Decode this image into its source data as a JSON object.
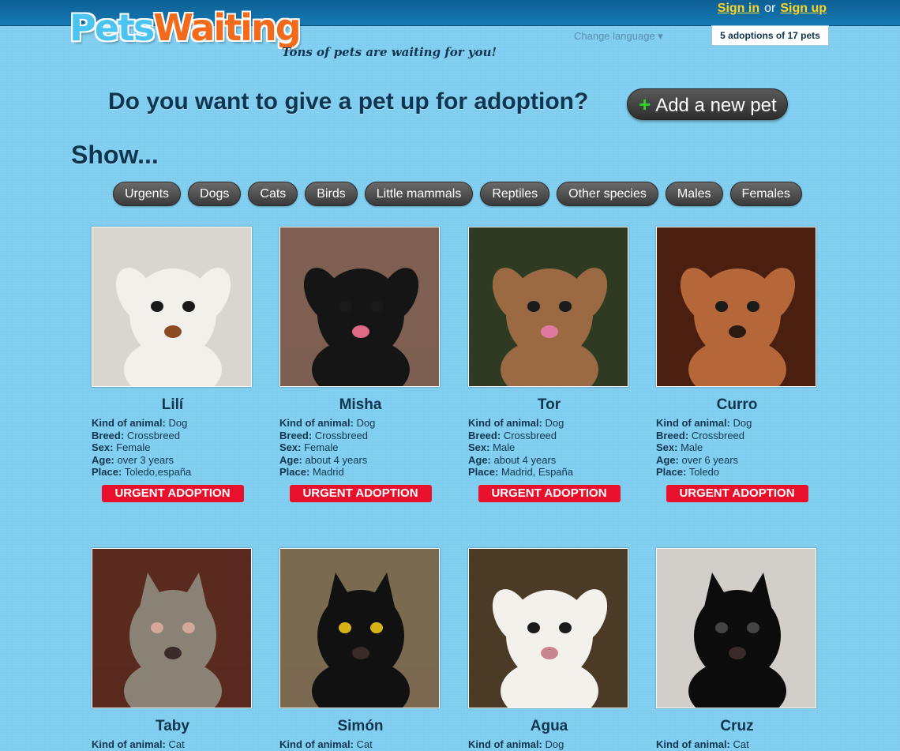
{
  "header": {
    "logo_part1": "Pets",
    "logo_part2": "Waiting",
    "tagline": "Tons of pets are waiting for you!",
    "sign_in": "Sign in",
    "or": "or",
    "sign_up": "Sign up",
    "change_language": "Change language ▾",
    "adoption_counter": "5 adoptions of 17 pets"
  },
  "hero": {
    "question": "Do you want to give a pet up for adoption?",
    "add_button_icon": "plus-icon",
    "add_button_label": "Add a new pet"
  },
  "show_title": "Show...",
  "filters": [
    "Urgents",
    "Dogs",
    "Cats",
    "Birds",
    "Little mammals",
    "Reptiles",
    "Other species",
    "Males",
    "Females"
  ],
  "labels": {
    "kind": "Kind of animal:",
    "breed": "Breed:",
    "sex": "Sex:",
    "age": "Age:",
    "place": "Place:",
    "urgent": "URGENT ADOPTION"
  },
  "pets": [
    {
      "name": "Lilí",
      "kind": "Dog",
      "breed": "Crossbreed",
      "sex": "Female",
      "age": "over 3 years",
      "place": "Toledo,españa",
      "urgent": true,
      "colors": {
        "bg": "#d9d6cf",
        "fur": "#f2f0ea",
        "spot": "#8a4a22"
      }
    },
    {
      "name": "Misha",
      "kind": "Dog",
      "breed": "Crossbreed",
      "sex": "Female",
      "age": "about 4 years",
      "place": "Madrid",
      "urgent": true,
      "colors": {
        "bg": "#7e5f52",
        "fur": "#151515",
        "spot": "#e06a86"
      }
    },
    {
      "name": "Tor",
      "kind": "Dog",
      "breed": "Crossbreed",
      "sex": "Male",
      "age": "about 4 years",
      "place": "Madrid, España",
      "urgent": true,
      "colors": {
        "bg": "#2f3a23",
        "fur": "#9b6a43",
        "spot": "#e07aa0"
      }
    },
    {
      "name": "Curro",
      "kind": "Dog",
      "breed": "Crossbreed",
      "sex": "Male",
      "age": "over 6 years",
      "place": "Toledo",
      "urgent": true,
      "colors": {
        "bg": "#4a1f10",
        "fur": "#b5673a",
        "spot": "#2a1a12"
      }
    },
    {
      "name": "Taby",
      "kind": "Cat",
      "colors": {
        "bg": "#5a2a1e",
        "fur": "#8b8276",
        "spot": "#d4a898"
      }
    },
    {
      "name": "Simón",
      "kind": "Cat",
      "colors": {
        "bg": "#7a6a50",
        "fur": "#111111",
        "spot": "#d7b317"
      }
    },
    {
      "name": "Agua",
      "kind": "Dog",
      "colors": {
        "bg": "#4a3a26",
        "fur": "#f4f0ec",
        "spot": "#c9868f"
      }
    },
    {
      "name": "Cruz",
      "kind": "Cat",
      "colors": {
        "bg": "#d2cfca",
        "fur": "#0c0c0c",
        "spot": "#444444"
      }
    }
  ]
}
